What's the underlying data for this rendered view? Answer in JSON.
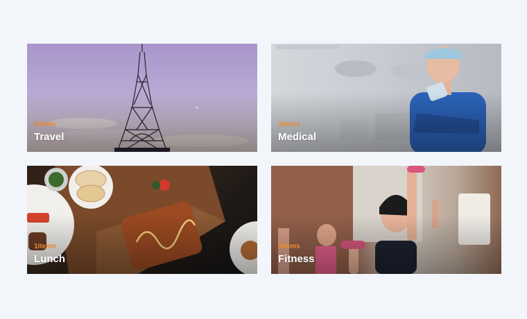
{
  "accent_color": "#e88a2e",
  "categories": [
    {
      "count": "2Items",
      "title": "Travel"
    },
    {
      "count": "3Items",
      "title": "Medical"
    },
    {
      "count": "1Items",
      "title": "Lunch"
    },
    {
      "count": "3Items",
      "title": "Fitness"
    }
  ]
}
